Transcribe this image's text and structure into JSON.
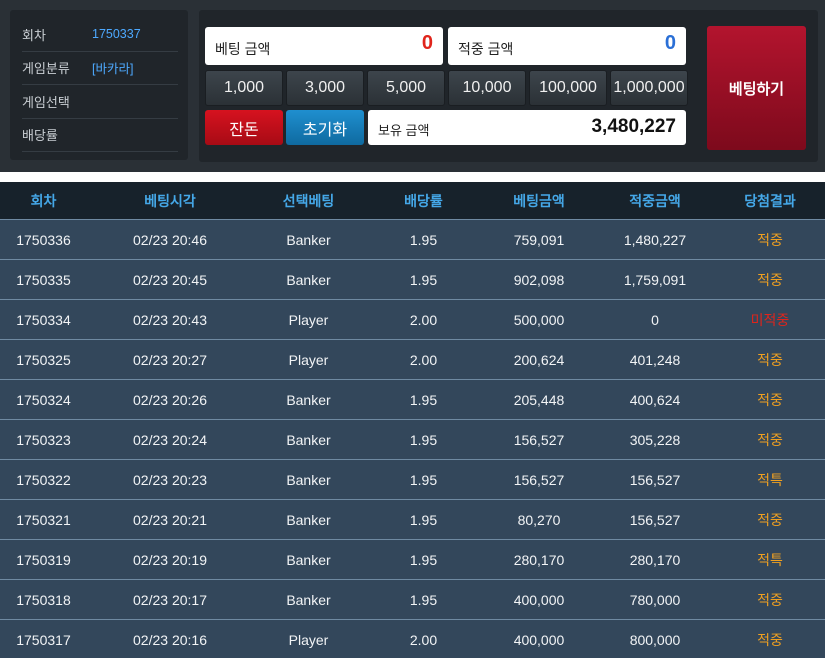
{
  "info": {
    "round_label": "회차",
    "round_value": "1750337",
    "category_label": "게임분류",
    "category_value": "[바카라]",
    "selection_label": "게임선택",
    "selection_value": "",
    "odds_label": "배당률",
    "odds_value": ""
  },
  "bet": {
    "amount_label": "베팅 금액",
    "amount_value": "0",
    "win_label": "적중 금액",
    "win_value": "0",
    "chips": [
      "1,000",
      "3,000",
      "5,000",
      "10,000",
      "100,000",
      "1,000,000"
    ],
    "remainder_label": "잔돈",
    "reset_label": "초기화",
    "balance_label": "보유 금액",
    "balance_value": "3,480,227",
    "submit_label": "베팅하기"
  },
  "colors": {
    "amount": "#e0241b",
    "win": "#2a6fd6",
    "win_result": "#f0a020",
    "lose_result": "#e0241b"
  },
  "table": {
    "headers": [
      "회차",
      "베팅시각",
      "선택베팅",
      "배당률",
      "베팅금액",
      "적중금액",
      "당첨결과"
    ],
    "rows": [
      {
        "round": "1750336",
        "time": "02/23 20:46",
        "pick": "Banker",
        "odds": "1.95",
        "bet": "759,091",
        "win": "1,480,227",
        "result": "적중",
        "status": "win"
      },
      {
        "round": "1750335",
        "time": "02/23 20:45",
        "pick": "Banker",
        "odds": "1.95",
        "bet": "902,098",
        "win": "1,759,091",
        "result": "적중",
        "status": "win"
      },
      {
        "round": "1750334",
        "time": "02/23 20:43",
        "pick": "Player",
        "odds": "2.00",
        "bet": "500,000",
        "win": "0",
        "result": "미적중",
        "status": "lose"
      },
      {
        "round": "1750325",
        "time": "02/23 20:27",
        "pick": "Player",
        "odds": "2.00",
        "bet": "200,624",
        "win": "401,248",
        "result": "적중",
        "status": "win"
      },
      {
        "round": "1750324",
        "time": "02/23 20:26",
        "pick": "Banker",
        "odds": "1.95",
        "bet": "205,448",
        "win": "400,624",
        "result": "적중",
        "status": "win"
      },
      {
        "round": "1750323",
        "time": "02/23 20:24",
        "pick": "Banker",
        "odds": "1.95",
        "bet": "156,527",
        "win": "305,228",
        "result": "적중",
        "status": "win"
      },
      {
        "round": "1750322",
        "time": "02/23 20:23",
        "pick": "Banker",
        "odds": "1.95",
        "bet": "156,527",
        "win": "156,527",
        "result": "적특",
        "status": "win"
      },
      {
        "round": "1750321",
        "time": "02/23 20:21",
        "pick": "Banker",
        "odds": "1.95",
        "bet": "80,270",
        "win": "156,527",
        "result": "적중",
        "status": "win"
      },
      {
        "round": "1750319",
        "time": "02/23 20:19",
        "pick": "Banker",
        "odds": "1.95",
        "bet": "280,170",
        "win": "280,170",
        "result": "적특",
        "status": "win"
      },
      {
        "round": "1750318",
        "time": "02/23 20:17",
        "pick": "Banker",
        "odds": "1.95",
        "bet": "400,000",
        "win": "780,000",
        "result": "적중",
        "status": "win"
      },
      {
        "round": "1750317",
        "time": "02/23 20:16",
        "pick": "Player",
        "odds": "2.00",
        "bet": "400,000",
        "win": "800,000",
        "result": "적중",
        "status": "win"
      }
    ]
  }
}
